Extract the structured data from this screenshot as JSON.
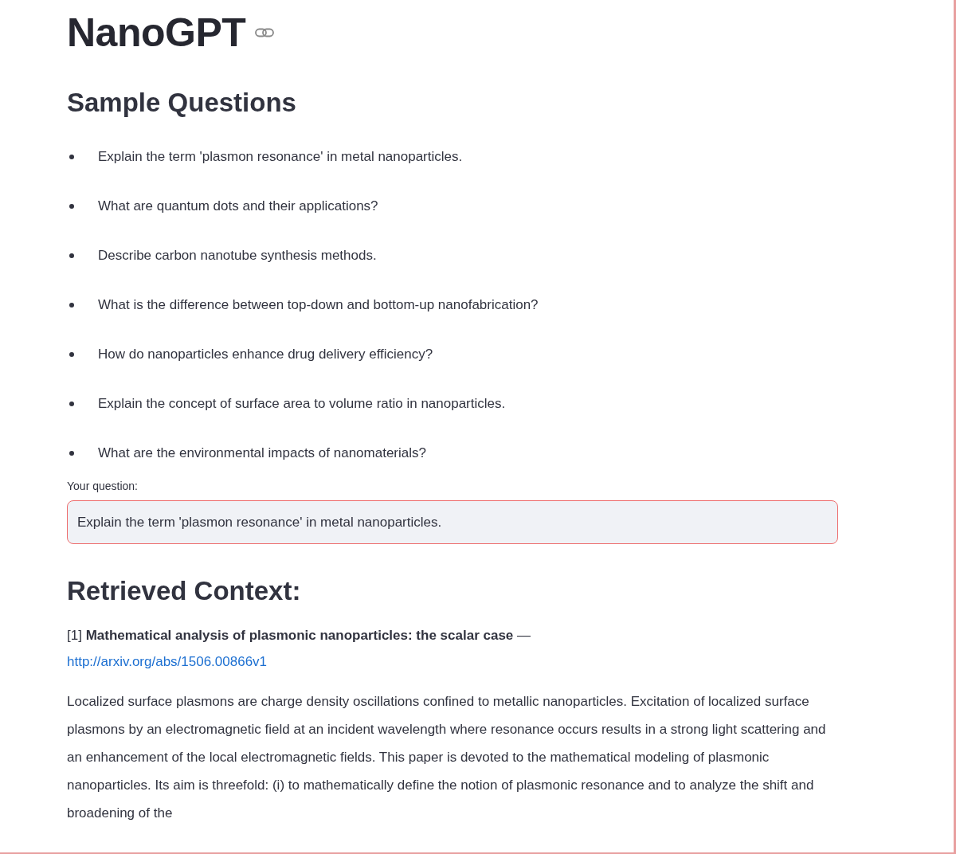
{
  "title": "NanoGPT",
  "sample_questions": {
    "heading": "Sample Questions",
    "items": [
      "Explain the term 'plasmon resonance' in metal nanoparticles.",
      "What are quantum dots and their applications?",
      "Describe carbon nanotube synthesis methods.",
      "What is the difference between top-down and bottom-up nanofabrication?",
      "How do nanoparticles enhance drug delivery efficiency?",
      "Explain the concept of surface area to volume ratio in nanoparticles.",
      "What are the environmental impacts of nanomaterials?"
    ]
  },
  "question_field": {
    "label": "Your question:",
    "value": "Explain the term 'plasmon resonance' in metal nanoparticles.",
    "focused": true
  },
  "context": {
    "heading": "Retrieved Context:",
    "results": [
      {
        "title": "[1] **Mathematical analysis of plasmonic nanoparticles: the scalar case** —",
        "link": "http://arxiv.org/abs/1506.00866v1",
        "abstract": "Localized surface plasmons are charge density oscillations confined to metallic nanoparticles. Excitation of localized surface plasmons by an electromagnetic field at an incident wavelength where resonance occurs results in a strong light scattering and an enhancement of the local electromagnetic fields. This paper is devoted to the mathematical modeling of plasmonic nanoparticles. Its aim is threefold: (i) to mathematically define the notion of plasmonic resonance and to analyze the shift and broadening of the"
      }
    ]
  }
}
